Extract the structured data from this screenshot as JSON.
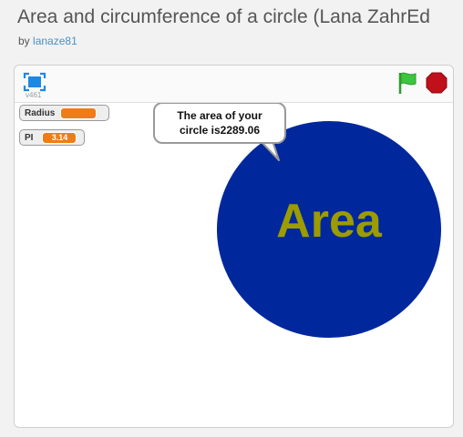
{
  "project": {
    "title": "Area and circumference of a circle (Lana ZahrEd",
    "by_label": "by",
    "author": "lanaze81"
  },
  "player": {
    "version": "v461",
    "fullscreen_icon": "fullscreen-icon",
    "green_flag_icon": "green-flag-icon",
    "stop_icon": "stop-sign-icon",
    "colors": {
      "flag": "#2fb92f",
      "stop": "#c0101a",
      "fullscreen": "#1e88e5"
    }
  },
  "stage": {
    "monitors": [
      {
        "label": "Radius",
        "value": ""
      },
      {
        "label": "PI",
        "value": "3.14"
      }
    ],
    "speech_bubble": {
      "line1": "The area of your",
      "line2": "circle is2289.06"
    },
    "sprite": {
      "label": "Area",
      "fill_color": "#00289c",
      "text_color": "#9c9c00"
    }
  }
}
